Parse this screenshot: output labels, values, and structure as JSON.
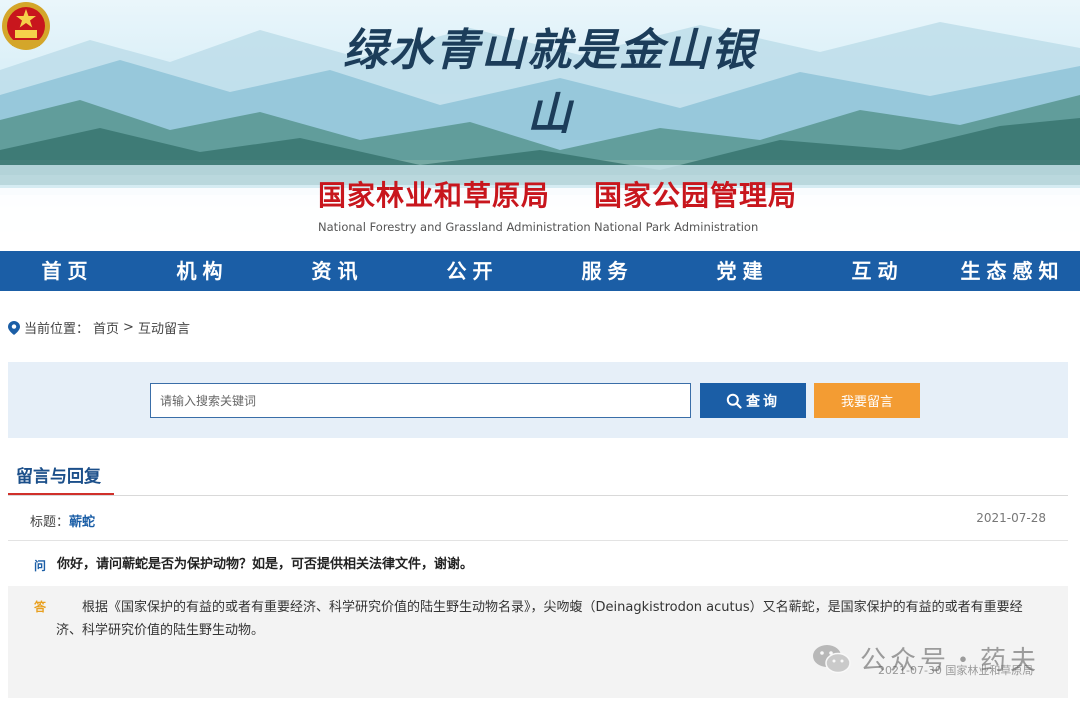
{
  "banner": {
    "slogan": "绿水青山就是金山银山",
    "agencies": [
      {
        "cn": "国家林业和草原局",
        "en": "National Forestry and Grassland Administration"
      },
      {
        "cn": "国家公园管理局",
        "en": "National Park Administration"
      }
    ]
  },
  "nav": {
    "items": [
      "首页",
      "机构",
      "资讯",
      "公开",
      "服务",
      "党建",
      "互动",
      "生态感知"
    ]
  },
  "breadcrumb": {
    "label": "当前位置：",
    "home": "首页",
    "separator": " > ",
    "current": "互动留言"
  },
  "search": {
    "placeholder": "请输入搜索关键词",
    "value": "",
    "search_label": "查询",
    "message_label": "我要留言"
  },
  "section": {
    "title": "留言与回复"
  },
  "post": {
    "title_label": "标题：",
    "title": "蕲蛇",
    "date": "2021-07-28",
    "question_badge": "问",
    "question": "你好，请问蕲蛇是否为保护动物？如是，可否提供相关法律文件，谢谢。",
    "answer_badge": "答",
    "answer": "根据《国家保护的有益的或者有重要经济、科学研究价值的陆生野生动物名录》，尖吻蝮（Deinagkistrodon acutus）又名蕲蛇，是国家保护的有益的或者有重要经济、科学研究价值的陆生野生动物。",
    "answer_date": "2021-07-30 国家林业和草原局"
  },
  "watermark": {
    "text": "公众号・药夫"
  },
  "colors": {
    "nav_blue": "#1b5ea6",
    "agency_red": "#c8161d",
    "orange_button": "#f39c33",
    "panel_bg": "#e6eff8"
  }
}
